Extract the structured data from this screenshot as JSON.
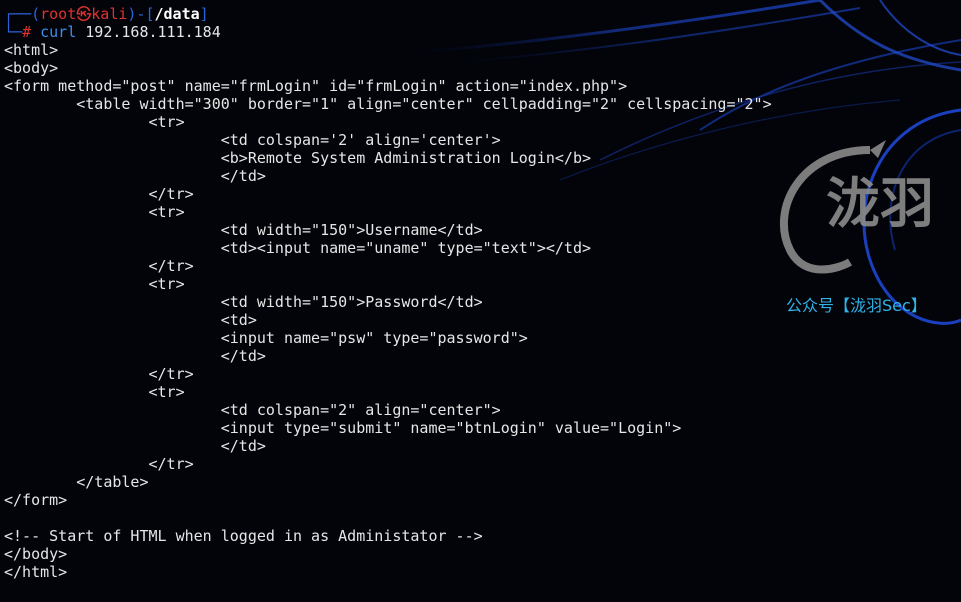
{
  "prompt": {
    "frame_top": "┌──(",
    "user": "root",
    "skull": "㉿",
    "host": "kali",
    "sep": ")-[",
    "dir": "/data",
    "close": "]",
    "frame_bottom": "└─",
    "hash": "#",
    "command": "curl",
    "args": "192.168.111.184"
  },
  "output_lines": [
    "<html>",
    "<body>",
    "<form method=\"post\" name=\"frmLogin\" id=\"frmLogin\" action=\"index.php\">",
    "        <table width=\"300\" border=\"1\" align=\"center\" cellpadding=\"2\" cellspacing=\"2\">",
    "                <tr>",
    "                        <td colspan='2' align='center'>",
    "                        <b>Remote System Administration Login</b>",
    "                        </td>",
    "                </tr>",
    "                <tr>",
    "                        <td width=\"150\">Username</td>",
    "                        <td><input name=\"uname\" type=\"text\"></td>",
    "                </tr>",
    "                <tr>",
    "                        <td width=\"150\">Password</td>",
    "                        <td>",
    "                        <input name=\"psw\" type=\"password\">",
    "                        </td>",
    "                </tr>",
    "                <tr>",
    "                        <td colspan=\"2\" align=\"center\">",
    "                        <input type=\"submit\" name=\"btnLogin\" value=\"Login\">",
    "                        </td>",
    "                </tr>",
    "        </table>",
    "</form>",
    "",
    "<!-- Start of HTML when logged in as Administator -->",
    "</body>",
    "</html>"
  ],
  "watermark": {
    "logo_text": "泷羽",
    "caption": "公众号【泷羽Sec】"
  },
  "colors": {
    "background": "#02040a",
    "prompt_frame": "#2a62d8",
    "prompt_user": "#e0312f",
    "command": "#3b8eea",
    "text": "#e6e6e6",
    "watermark_caption": "#2fb4e8",
    "wallpaper_lines": "#1a3fb0"
  }
}
